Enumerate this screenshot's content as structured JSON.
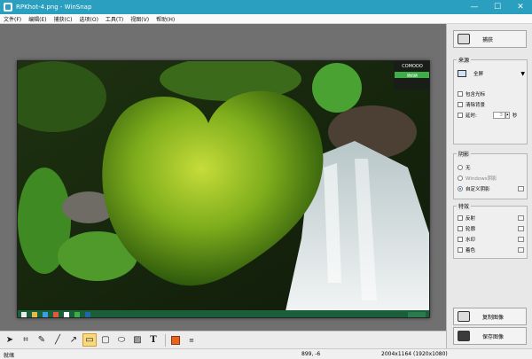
{
  "window": {
    "title": "RPKhot-4.png - WinSnap",
    "controls": [
      "—",
      "☐",
      "✕"
    ]
  },
  "menu": [
    "文件(F)",
    "编辑(E)",
    "捕获(C)",
    "选项(O)",
    "工具(T)",
    "视图(V)",
    "帮助(H)"
  ],
  "photo": {
    "overlay_brand": "COMOOO",
    "overlay_button": "随机换"
  },
  "panel": {
    "capture_label": "捕获",
    "source": {
      "title": "来源",
      "mode": "全屏",
      "include_cursor": "包含光标",
      "clear_background": "清除背景",
      "delay_label": "延时:",
      "delay_value": "3",
      "delay_unit": "秒"
    },
    "shadow": {
      "title": "阴影",
      "none": "无",
      "aero": "Windows阴影",
      "custom": "自定义阴影"
    },
    "effects": {
      "title": "特效",
      "reflection": "反射",
      "outline": "轮廓",
      "watermark": "水印",
      "tint": "着色"
    },
    "copy_label": "复制图像",
    "save_label": "保存图像"
  },
  "status": {
    "state": "就绪",
    "coords": "899, -6",
    "dims": "2004x1164 (1920x1080)"
  },
  "colors": {
    "titlebar": "#2a9fbf",
    "tool_highlight": "#f7d980",
    "fill_color": "#e8631c"
  }
}
